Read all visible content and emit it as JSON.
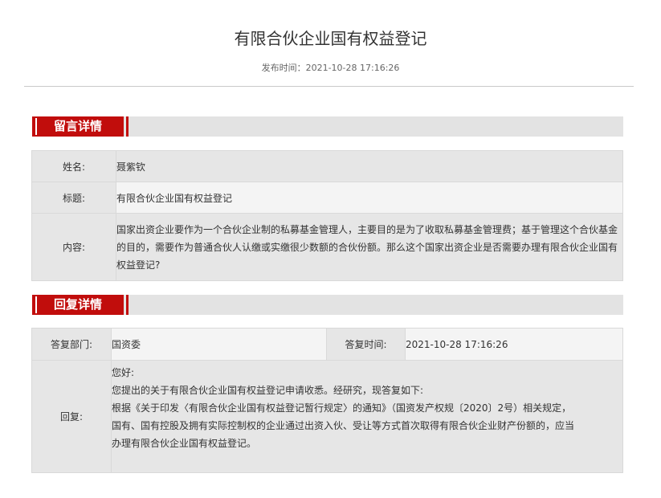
{
  "article": {
    "title": "有限合伙企业国有权益登记",
    "publish_label": "发布时间：",
    "publish_time": "2021-10-28 17:16:26"
  },
  "message": {
    "section_title": "留言详情",
    "name_label": "姓名:",
    "name_value": "聂紫钦",
    "subject_label": "标题:",
    "subject_value": "有限合伙企业国有权益登记",
    "content_label": "内容:",
    "content_value": "国家出资企业要作为一个合伙企业制的私募基金管理人，主要目的是为了收取私募基金管理费；基于管理这个合伙基金的目的，需要作为普通合伙人认缴或实缴很少数额的合伙份额。那么这个国家出资企业是否需要办理有限合伙企业国有权益登记?"
  },
  "reply": {
    "section_title": "回复详情",
    "dept_label": "答复部门:",
    "dept_value": "国资委",
    "time_label": "答复时间:",
    "time_value": "2021-10-28 17:16:26",
    "reply_label": "回复:",
    "lines": [
      "您好:",
      " 您提出的关于有限合伙企业国有权益登记申请收悉。经研究，现答复如下:",
      " 根据《关于印发〈有限合伙企业国有权益登记暂行规定〉的通知》（国资发产权规〔2020〕2号）相关规定，",
      "国有、国有控股及拥有实际控制权的企业通过出资入伙、受让等方式首次取得有限合伙企业财产份额的，应当",
      "办理有限合伙企业国有权益登记。"
    ]
  }
}
